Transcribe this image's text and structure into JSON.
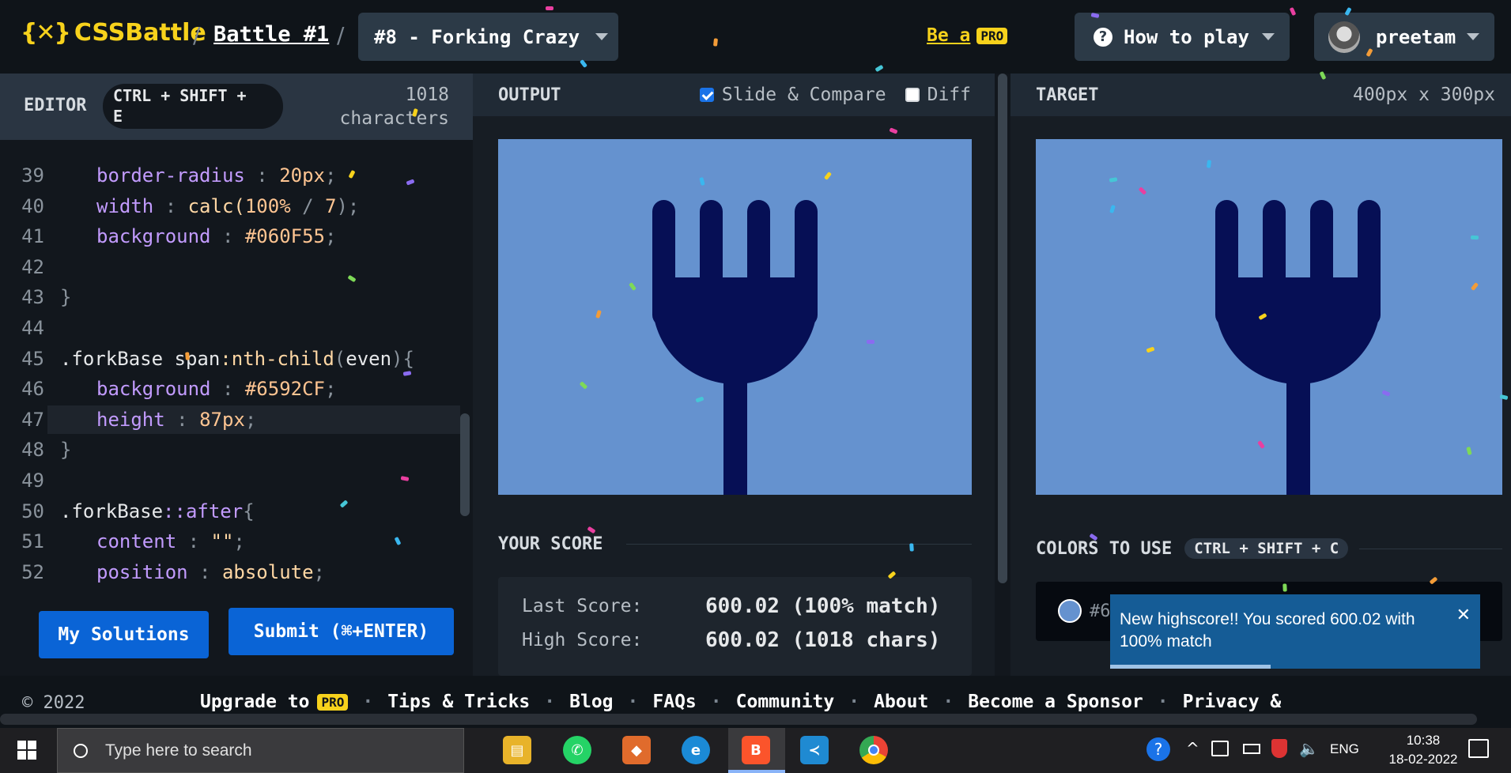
{
  "header": {
    "logo_mark": "{✕}",
    "logo_text": "CSSBattle",
    "sep": "/",
    "battle_link": "Battle #1",
    "target_selector": "#8 - Forking Crazy",
    "be_a": "Be a",
    "pro_badge": "PRO",
    "how_to_play": "How to play",
    "username": "preetam"
  },
  "editor": {
    "title": "EDITOR",
    "shortcut_line1": "CTRL + SHIFT +",
    "shortcut_line2": "E",
    "char_count": "1018",
    "char_unit": "characters",
    "lines": [
      {
        "n": "39"
      },
      {
        "n": "40"
      },
      {
        "n": "41"
      },
      {
        "n": "42"
      },
      {
        "n": "43"
      },
      {
        "n": "44"
      },
      {
        "n": "45"
      },
      {
        "n": "46"
      },
      {
        "n": "47"
      },
      {
        "n": "48"
      },
      {
        "n": "49"
      },
      {
        "n": "50"
      },
      {
        "n": "51"
      },
      {
        "n": "52"
      }
    ],
    "code": {
      "l39_prop": "border-radius",
      "l39_val": "20px",
      "l40_prop": "width",
      "l40_fn": "calc(",
      "l40_a": "100%",
      "l40_op": " / ",
      "l40_b": "7",
      "l40_end": ");",
      "l41_prop": "background",
      "l41_val": "#060F55",
      "l43": "}",
      "l45_sel": ".forkBase span",
      "l45_pseudo": ":nth-child",
      "l45_arg": "(even){",
      "l45_even": "even",
      "l46_prop": "background",
      "l46_val": "#6592CF",
      "l47_prop": "height",
      "l47_val": "87px",
      "l48": "}",
      "l50_sel": ".forkBase",
      "l50_pseudo": "::after",
      "l50_brace": "{",
      "l51_prop": "content",
      "l51_val": "\"\"",
      "l52_prop": "position",
      "l52_val": "absolute",
      "colon": " : ",
      "semi": ";"
    },
    "my_solutions": "My Solutions",
    "submit": "Submit (⌘+ENTER)"
  },
  "output": {
    "title": "OUTPUT",
    "slide_compare": "Slide & Compare",
    "slide_compare_checked": true,
    "diff": "Diff",
    "diff_checked": false,
    "your_score": "YOUR SCORE",
    "last_score_label": "Last Score:",
    "last_score_value": "600.02 (100% match)",
    "high_score_label": "High Score:",
    "high_score_value": "600.02 (1018 chars)"
  },
  "target": {
    "title": "TARGET",
    "dimensions": "400px x 300px",
    "colors_to_use": "COLORS TO USE",
    "colors_shortcut": "CTRL + SHIFT + C",
    "color1_partial": "#6",
    "colors": {
      "bg": "#6592CF",
      "fork": "#060F55"
    }
  },
  "toast": {
    "message": "New highscore!! You scored 600.02 with 100% match",
    "close": "✕"
  },
  "footer": {
    "copyright": "© 2022",
    "upgrade_to": "Upgrade to",
    "pro_badge": "PRO",
    "links": [
      "Tips & Tricks",
      "Blog",
      "FAQs",
      "Community",
      "About",
      "Become a Sponsor",
      "Privacy &"
    ],
    "dot": "·"
  },
  "taskbar": {
    "search_placeholder": "Type here to search",
    "lang": "ENG",
    "time": "10:38",
    "date": "18-02-2022",
    "apps": [
      "file-explorer",
      "whatsapp",
      "git-tool",
      "edge",
      "brave",
      "vscode",
      "chrome"
    ]
  },
  "theme": {
    "accent": "#f7d21c",
    "link_blue": "#0a64d6"
  }
}
